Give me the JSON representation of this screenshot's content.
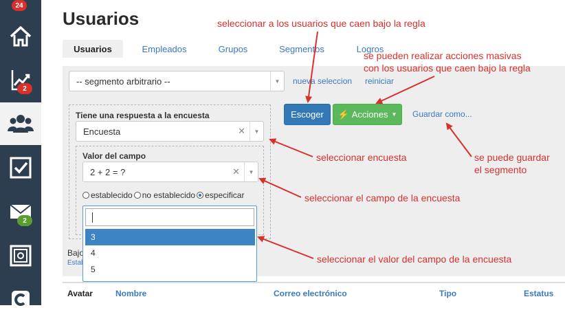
{
  "sidebar": {
    "items": [
      {
        "icon": "notification-icon",
        "badge": "24",
        "badge_color": "#d9302b"
      },
      {
        "icon": "home-icon",
        "badge": ""
      },
      {
        "icon": "chart-icon",
        "badge": "2",
        "badge_color": "#d9302b"
      },
      {
        "icon": "users-icon",
        "badge": "",
        "active": true
      },
      {
        "icon": "checkbox-icon",
        "badge": ""
      },
      {
        "icon": "mail-icon",
        "badge": "2",
        "badge_color": "#5a9e2f"
      },
      {
        "icon": "safe-icon",
        "badge": ""
      },
      {
        "icon": "logo-c-icon",
        "badge": ""
      }
    ]
  },
  "page": {
    "title": "Usuarios"
  },
  "tabs": [
    {
      "label": "Usuarios",
      "active": true
    },
    {
      "label": "Empleados"
    },
    {
      "label": "Grupos"
    },
    {
      "label": "Segmentos"
    },
    {
      "label": "Logros"
    }
  ],
  "segment": {
    "selected": "-- segmento arbitrario --",
    "new_selection": "nueva seleccion",
    "reset": "reiniciar"
  },
  "rule": {
    "title": "Tiene una respuesta a la encuesta",
    "survey_value": "Encuesta",
    "field_title": "Valor del campo",
    "field_value": "2 + 2 = ?",
    "radio_options": [
      {
        "label": "establecido",
        "checked": false
      },
      {
        "label": "no establecido",
        "checked": false
      },
      {
        "label": "especificar",
        "checked": true
      }
    ],
    "dropdown_options": [
      "3",
      "4",
      "5"
    ],
    "highlighted_option": "3"
  },
  "buttons": {
    "choose": "Escoger",
    "actions": "Acciones",
    "save_as": "Guardar como..."
  },
  "bottom_fragments": {
    "bajo": "Bajo",
    "estab": "Estab"
  },
  "table": {
    "headers": [
      "Avatar",
      "Nombre",
      "Correo electrónico",
      "Tipo",
      "Estatus"
    ]
  },
  "annotations": {
    "a1": "seleccionar a los usuarios que caen bajo la regla",
    "a2_line1": "se pueden realizar acciones masivas",
    "a2_line2": "con los usuarios que caen bajo la regla",
    "a3": "seleccionar encuesta",
    "a4_line1": "se puede guardar",
    "a4_line2": "el segmento",
    "a5": "seleccionar el campo de la encuesta",
    "a6": "seleccionar el valor del campo de la encuesta"
  },
  "colors": {
    "sidebar": "#2c3e50",
    "accent_blue": "#3479b7",
    "accent_green": "#5cb85c",
    "annotation_red": "#d9302b"
  }
}
